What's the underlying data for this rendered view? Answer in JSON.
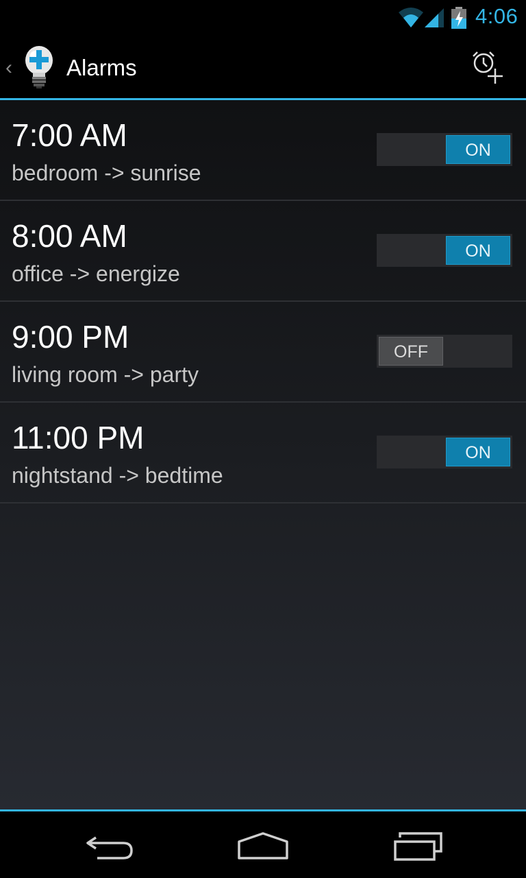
{
  "status_bar": {
    "time": "4:06",
    "icons": [
      "wifi-icon",
      "signal-icon",
      "battery-charging-icon"
    ],
    "accent_color": "#33b5e5"
  },
  "action_bar": {
    "title": "Alarms",
    "icons": [
      "up-caret-icon",
      "lightbulb-plus-icon",
      "add-alarm-icon"
    ]
  },
  "alarms": [
    {
      "time": "7:00 AM",
      "label": "bedroom -> sunrise",
      "enabled": true,
      "toggle_text": "ON"
    },
    {
      "time": "8:00 AM",
      "label": "office -> energize",
      "enabled": true,
      "toggle_text": "ON"
    },
    {
      "time": "9:00 PM",
      "label": "living room -> party",
      "enabled": false,
      "toggle_text": "OFF"
    },
    {
      "time": "11:00 PM",
      "label": "nightstand -> bedtime",
      "enabled": true,
      "toggle_text": "ON"
    }
  ],
  "nav_bar": {
    "icons": [
      "back-icon",
      "home-icon",
      "recents-icon"
    ]
  }
}
